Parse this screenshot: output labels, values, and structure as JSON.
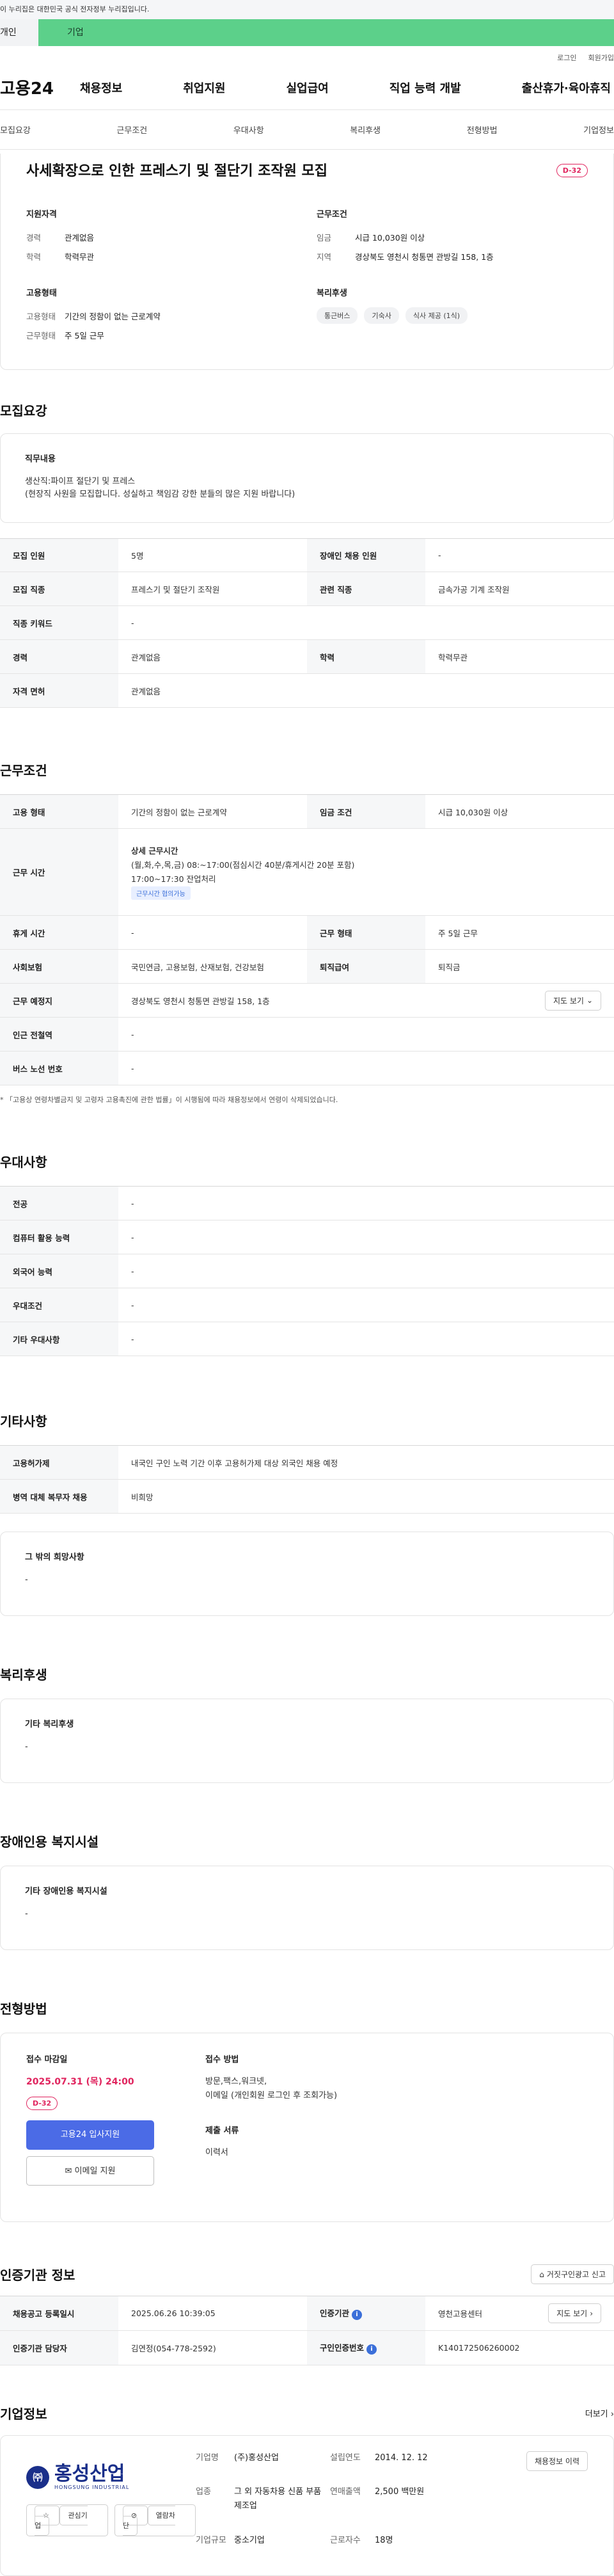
{
  "gov_banner": "이 누리집은 대한민국 공식 전자정부 누리집입니다.",
  "user_tabs": {
    "individual": "개인",
    "company": "기업"
  },
  "top_links": {
    "login": "로그인",
    "join": "회원가입"
  },
  "logo": "고용24",
  "gnb": [
    "채용정보",
    "취업지원",
    "실업급여",
    "직업 능력 개발",
    "출산휴가·육아휴직"
  ],
  "subnav": [
    "모집요강",
    "근무조건",
    "우대사항",
    "복리후생",
    "전형방법",
    "기업정보"
  ],
  "hero": {
    "title": "사세확장으로 인한 프레스기 및 절단기 조작원 모집",
    "dday": "D-32",
    "qualification": {
      "heading": "지원자격",
      "rows": [
        {
          "k": "경력",
          "v": "관계없음"
        },
        {
          "k": "학력",
          "v": "학력무관"
        }
      ]
    },
    "conditions": {
      "heading": "근무조건",
      "rows": [
        {
          "k": "임금",
          "v": "시급 10,030원 이상"
        },
        {
          "k": "지역",
          "v": "경상북도 영천시 청통면 관방길 158, 1층"
        }
      ]
    },
    "employment": {
      "heading": "고용형태",
      "rows": [
        {
          "k": "고용형태",
          "v": "기간의 정함이 없는 근로계약"
        },
        {
          "k": "근무형태",
          "v": "주 5일 근무"
        }
      ]
    },
    "welfare": {
      "heading": "복리후생",
      "chips": [
        "통근버스",
        "기숙사",
        "식사 제공 (1식)"
      ]
    }
  },
  "recruit": {
    "title": "모집요강",
    "duty_heading": "직무내용",
    "duty_lines": [
      "생산직:파이프 절단기 및 프레스",
      "(현장직 사원을 모집합니다. 성실하고 책임감 강한 분들의 많은 지원 바랍니다)"
    ],
    "rows": [
      {
        "k1": "모집 인원",
        "v1": "5명",
        "k2": "장애인 채용 인원",
        "v2": "-"
      },
      {
        "k1": "모집 직종",
        "v1": "프레스기 및 절단기 조작원",
        "k2": "관련 직종",
        "v2": "금속가공 기계 조작원"
      },
      {
        "k1": "직종 키워드",
        "v1": "-"
      },
      {
        "k1": "경력",
        "v1": "관계없음",
        "k2": "학력",
        "v2": "학력무관"
      },
      {
        "k1": "자격 면허",
        "v1": "관계없음"
      }
    ]
  },
  "work": {
    "title": "근무조건",
    "r1": {
      "k1": "고용 형태",
      "v1": "기간의 정함이 없는 근로계약",
      "k2": "임금 조건",
      "v2": "시급 10,030원 이상"
    },
    "hours_label": "근무 시간",
    "hours_title": "상세 근무시간",
    "hours_lines": [
      "(월,화,수,목,금) 08:~17:00(점심시간 40분/휴게시간 20분 포함)",
      "17:00~17:30 잔업처리"
    ],
    "hours_tag": "근무시간 협의가능",
    "r3": {
      "k1": "휴게 시간",
      "v1": "-",
      "k2": "근무 형태",
      "v2": "주 5일 근무"
    },
    "r4": {
      "k1": "사회보험",
      "v1": "국민연금, 고용보험, 산재보험, 건강보험",
      "k2": "퇴직급여",
      "v2": "퇴직금"
    },
    "r5": {
      "k1": "근무 예정지",
      "v1": "경상북도 영천시 청통면 관방길 158, 1층",
      "btn": "지도 보기"
    },
    "r6": {
      "k1": "인근 전철역",
      "v1": "-"
    },
    "r7": {
      "k1": "버스 노선 번호",
      "v1": "-"
    },
    "note": "「고용상 연령차별금지 및 고령자 고용촉진에 관한 법률」이 시행됨에 따라 채용정보에서 연령이 삭제되었습니다."
  },
  "preference": {
    "title": "우대사항",
    "rows": [
      {
        "k": "전공",
        "v": "-"
      },
      {
        "k": "컴퓨터 활용 능력",
        "v": "-"
      },
      {
        "k": "외국어 능력",
        "v": "-"
      },
      {
        "k": "우대조건",
        "v": "-"
      },
      {
        "k": "기타 우대사항",
        "v": "-"
      }
    ]
  },
  "other": {
    "title": "기타사항",
    "rows": [
      {
        "k": "고용허가제",
        "v": "내국인 구인 노력 기간 이후 고용허가제 대상 외국인 채용 예정"
      },
      {
        "k": "병역 대체 복무자 채용",
        "v": "비희망"
      }
    ],
    "card_title": "그 밖의 희망사항",
    "card_value": "-"
  },
  "benefits": {
    "title": "복리후생",
    "card_title": "기타 복리후생",
    "card_value": "-"
  },
  "disability": {
    "title": "장애인용 복지시설",
    "card_title": "기타 장애인용 복지시설",
    "card_value": "-"
  },
  "screening": {
    "title": "전형방법",
    "deadline_label": "접수 마감일",
    "deadline": "2025.07.31 (목) 24:00",
    "dday": "D-32",
    "apply_btn": "고용24 입사지원",
    "email_btn": "이메일 지원",
    "method_label": "접수 방법",
    "method_lines": [
      "방문,팩스,워크넷,",
      "이메일 (개인회원 로그인 후 조회가능)"
    ],
    "docs_label": "제출 서류",
    "docs_value": "이력서"
  },
  "agency": {
    "title": "인증기관 정보",
    "report_btn": "거짓구인광고 신고",
    "r1": {
      "k1": "채용공고 등록일시",
      "v1": "2025.06.26 10:39:05",
      "k2": "인증기관",
      "v2": "영천고용센터",
      "btn": "지도 보기"
    },
    "r2": {
      "k1": "인증기관 담당자",
      "v1": "김연정(054-778-2592)",
      "k2": "구인인증번호",
      "v2": "K140172506260002"
    }
  },
  "company": {
    "title": "기업정보",
    "more": "더보기",
    "logo_mark": "㈜",
    "logo_name": "홍성산업",
    "logo_en": "HONGSUNG INDUSTRIAL",
    "fav_btn": "관심기업",
    "block_btn": "열람차단",
    "info": [
      {
        "k": "기업명",
        "v": "(주)홍성산업",
        "k2": "설립연도",
        "v2": "2014. 12. 12"
      },
      {
        "k": "업종",
        "v": "그 외 자동차용 신품 부품 제조업",
        "k2": "연매출액",
        "v2": "2,500 백만원"
      },
      {
        "k": "기업규모",
        "v": "중소기업",
        "k2": "근로자수",
        "v2": "18명"
      }
    ],
    "history_btn": "채용정보 이력"
  }
}
